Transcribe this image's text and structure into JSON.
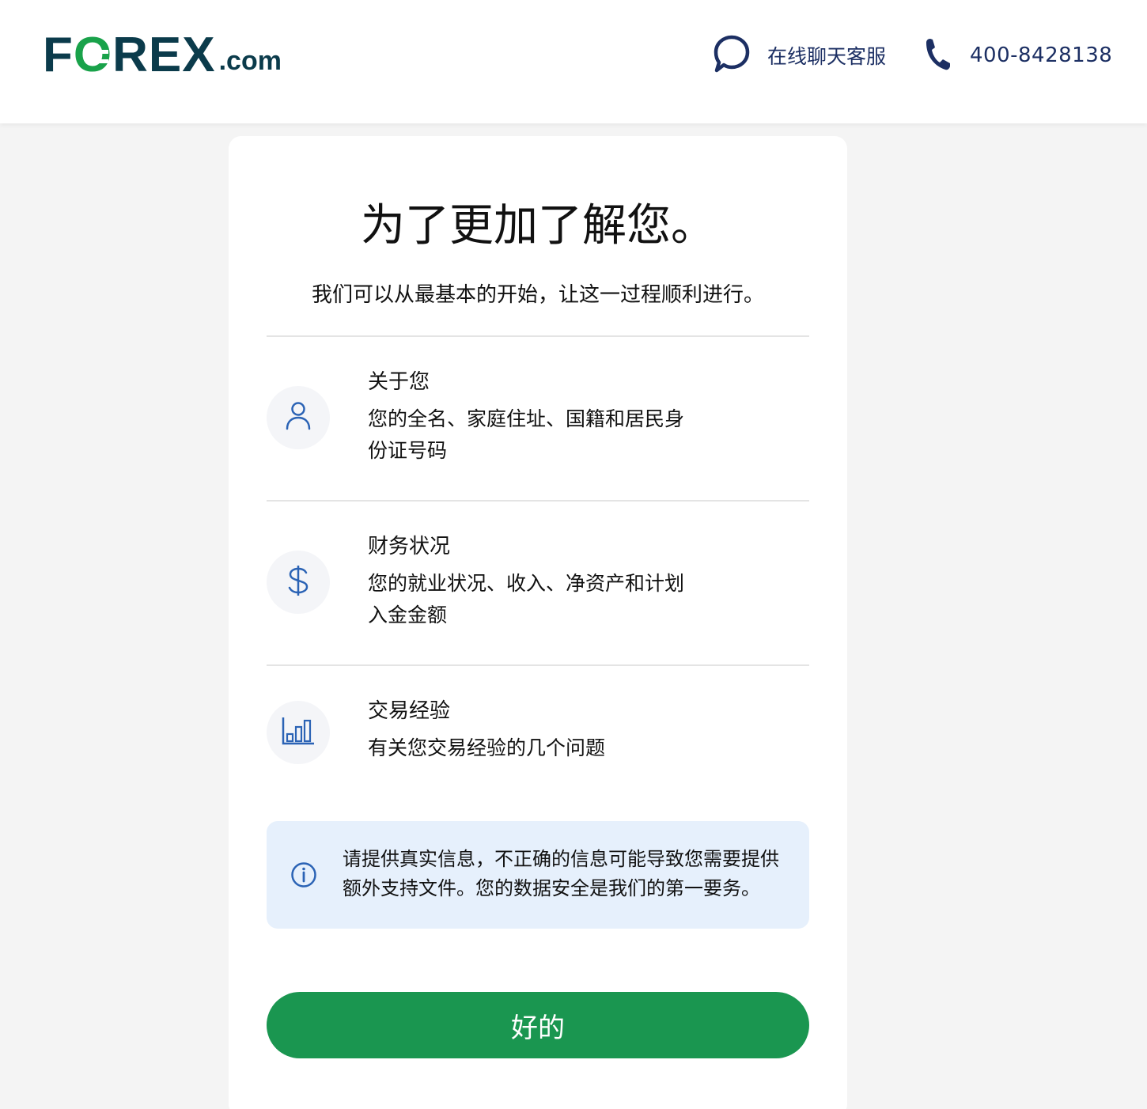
{
  "header": {
    "logo": {
      "part1": "F",
      "part2": "O",
      "part3": "REX",
      "suffix": ".com"
    },
    "chat_label": "在线聊天客服",
    "phone_number": "400-8428138"
  },
  "card": {
    "title": "为了更加了解您。",
    "subtitle": "我们可以从最基本的开始，让这一过程顺利进行。",
    "sections": [
      {
        "icon": "user-icon",
        "title": "关于您",
        "desc_line1": "您的全名、家庭住址、国籍和居民身",
        "desc_line2": "份证号码"
      },
      {
        "icon": "dollar-icon",
        "title": "财务状况",
        "desc_line1": "您的就业状况、收入、净资产和计划",
        "desc_line2": "入金金额"
      },
      {
        "icon": "bar-chart-icon",
        "title": "交易经验",
        "desc_line1": "有关您交易经验的几个问题",
        "desc_line2": ""
      }
    ],
    "info": {
      "line1": "请提供真实信息，不正确的信息可能导致您需要提供",
      "line2": "额外支持文件。您的数据安全是我们的第一要务。"
    },
    "ok_label": "好的"
  },
  "colors": {
    "brand_navy": "#0b3b4b",
    "brand_green": "#19a24a",
    "button_green": "#1a9650",
    "link_navy": "#1c2f63",
    "icon_blue": "#2b63b5",
    "info_bg": "#e6f0fc"
  }
}
